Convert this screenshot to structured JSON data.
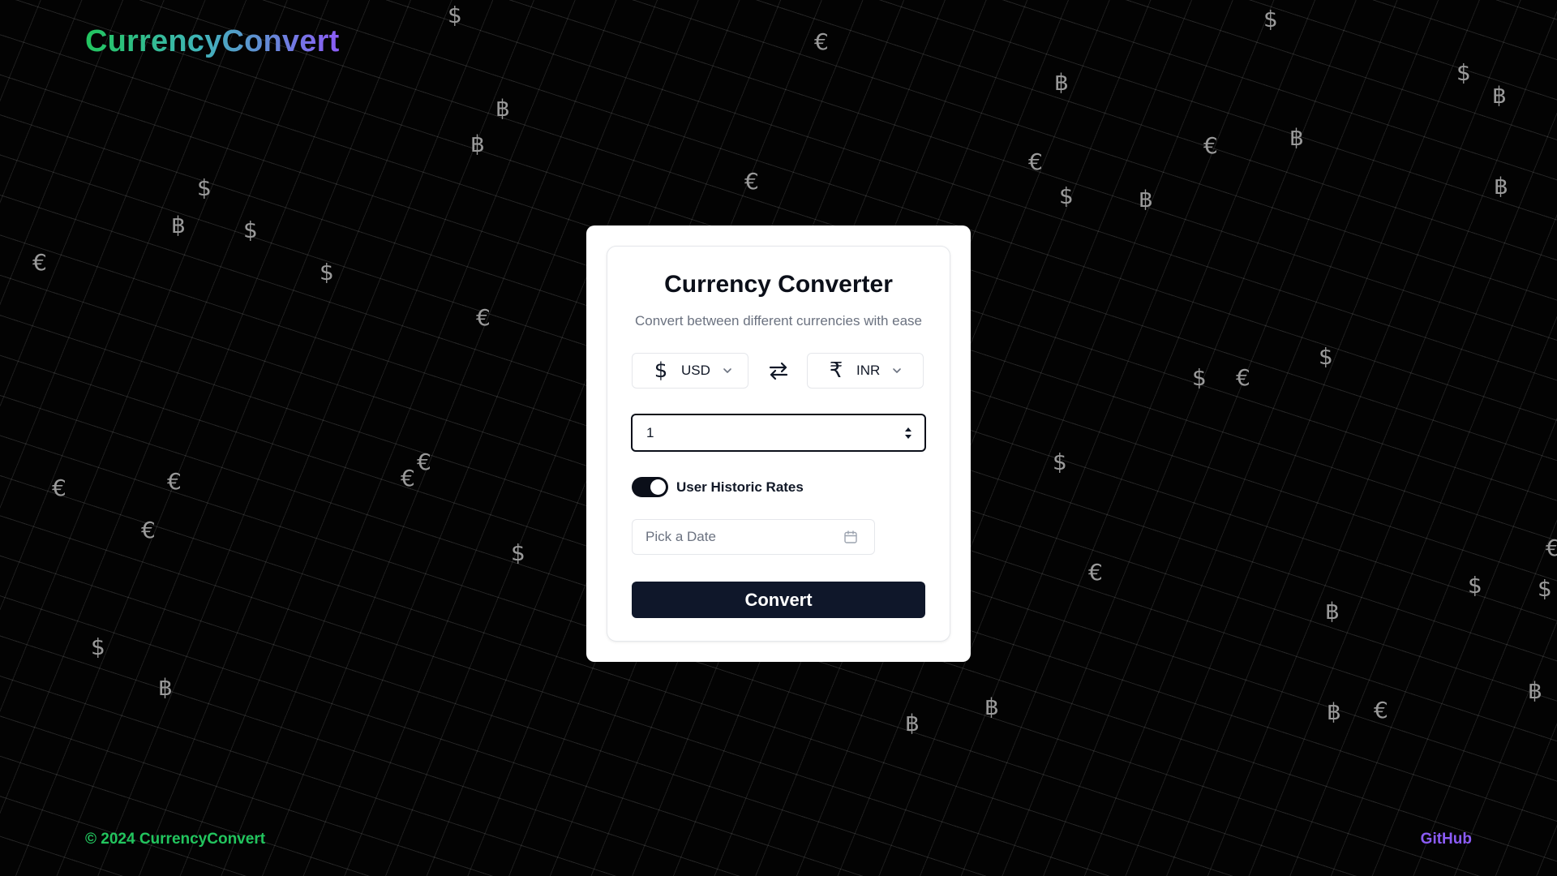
{
  "header": {
    "logo_text": "CurrencyConvert"
  },
  "card": {
    "title": "Currency Converter",
    "subtitle": "Convert between different currencies with ease",
    "from_currency": {
      "code": "USD",
      "symbol": "$",
      "icon": "dollar-icon"
    },
    "to_currency": {
      "code": "INR",
      "symbol": "₹",
      "icon": "rupee-icon"
    },
    "swap_icon": "swap-icon",
    "amount_value": "1",
    "historic_toggle": {
      "label": "User Historic Rates",
      "checked": true
    },
    "date_picker": {
      "placeholder": "Pick a Date",
      "icon": "calendar-icon"
    },
    "convert_label": "Convert"
  },
  "background_symbols": [
    "$",
    "€",
    "฿"
  ],
  "footer": {
    "copyright": "© 2024 CurrencyConvert",
    "link_label": "GitHub"
  },
  "colors": {
    "brand_green": "#22c55e",
    "brand_teal": "#3fb5b8",
    "brand_purple": "#8b5cf6",
    "button_dark": "#0f172a",
    "background": "#030303"
  }
}
